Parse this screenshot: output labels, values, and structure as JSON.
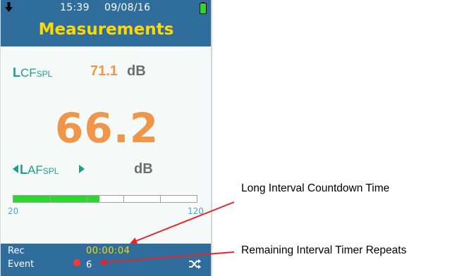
{
  "status_bar": {
    "time": "15:39",
    "date": "09/08/16",
    "download_icon": "download-arrow-icon",
    "battery_icon": "battery-icon"
  },
  "header": {
    "title": "Measurements"
  },
  "measurements": {
    "secondary": {
      "label_prefix": "L",
      "label_mid": "CF",
      "label_sub": "SPL",
      "value": "71.1",
      "unit": "dB"
    },
    "primary": {
      "value": "66.2",
      "label_prefix": "L",
      "label_mid": "AF",
      "label_sub": "SPL",
      "unit": "dB"
    },
    "level_bar": {
      "scale_min": "20",
      "scale_max": "120",
      "fill_fraction": 0.47,
      "segments": 5
    }
  },
  "footer": {
    "rec_label": "Rec",
    "event_label": "Event",
    "countdown_time": "00:00:04",
    "remaining_repeats": "6",
    "shuffle_icon": "shuffle-icon"
  },
  "annotations": {
    "countdown": "Long Interval Countdown Time",
    "repeats": "Remaining Interval Timer Repeats"
  },
  "colors": {
    "header_bg": "#2f6e9c",
    "title": "#ffd800",
    "value_orange": "#f0964a",
    "label_teal": "#1e9f8a",
    "bar_fill": "#2dd82d",
    "arrow_red": "#e8232a"
  }
}
